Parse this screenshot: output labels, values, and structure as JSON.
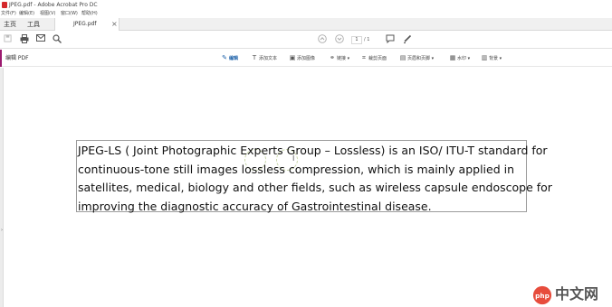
{
  "window": {
    "title": "JPEG.pdf - Adobe Acrobat Pro DC",
    "icon": "acrobat-icon"
  },
  "menubar": {
    "items": [
      "文件(F)",
      "编辑(E)",
      "视图(V)",
      "窗口(W)",
      "帮助(H)"
    ]
  },
  "tabs": {
    "home": "主页",
    "tools": "工具",
    "document": "JPEG.pdf",
    "close_icon": "close-icon"
  },
  "toolbar": {
    "icons": [
      "save-icon",
      "print-icon",
      "email-icon",
      "search-icon",
      "prev-page-icon",
      "next-page-icon",
      "comment-icon",
      "pen-icon"
    ],
    "current_page": "1",
    "total_pages": "/ 1"
  },
  "edit_pdf": {
    "title": "编辑 PDF",
    "tools": [
      {
        "label": "编辑",
        "icon": "edit-icon",
        "active": true
      },
      {
        "label": "添加文本",
        "icon": "add-text-icon"
      },
      {
        "label": "添加图像",
        "icon": "add-image-icon"
      },
      {
        "label": "链接 ▾",
        "icon": "link-icon"
      },
      {
        "label": "裁剪页面",
        "icon": "crop-icon"
      },
      {
        "label": "页眉和页脚 ▾",
        "icon": "header-footer-icon"
      },
      {
        "label": "水印 ▾",
        "icon": "watermark-icon"
      },
      {
        "label": "背景 ▾",
        "icon": "background-icon"
      }
    ],
    "accent_color": "#9b1a6f",
    "active_color": "#1a5fa8"
  },
  "document": {
    "lines": [
      "JPEG-LS ( Joint Photographic Experts Group – Lossless) is an ISO/ ITU-T standard for",
      "continuous-tone still images lossless compression, which is mainly applied in",
      "satellites, medical, biology and other fields, such as wireless capsule endoscope for",
      "improving the diagnostic accuracy of Gastrointestinal disease."
    ],
    "cursor": "I"
  },
  "watermark": {
    "text": "中文网",
    "logo": "php-logo"
  }
}
